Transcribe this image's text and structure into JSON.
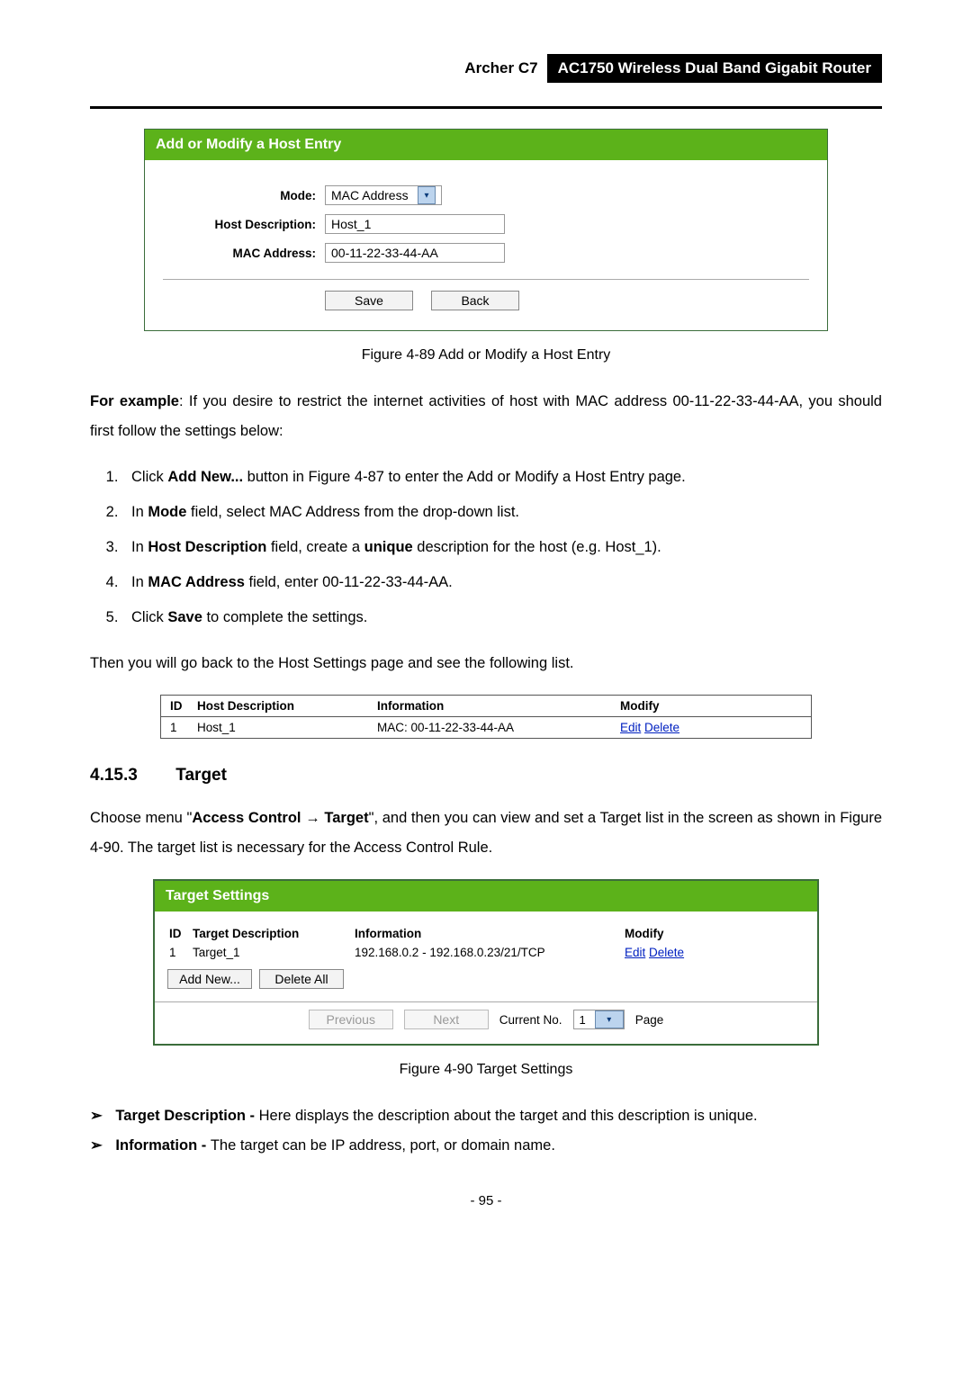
{
  "header": {
    "left": "Archer C7",
    "right": "AC1750 Wireless Dual Band Gigabit Router"
  },
  "host_panel": {
    "title": "Add or Modify a Host Entry",
    "mode_label": "Mode:",
    "mode_value": "MAC Address",
    "desc_label": "Host Description:",
    "desc_value": "Host_1",
    "mac_label": "MAC Address:",
    "mac_value": "00-11-22-33-44-AA",
    "save": "Save",
    "back": "Back"
  },
  "fig1_caption": "Figure 4-89 Add or Modify a Host Entry",
  "para1_a": "For example",
  "para1_b": ": If you desire to restrict the internet activities of host with MAC address 00-11-22-33-44-AA, you should first follow the settings below:",
  "steps": {
    "s1a": "Click ",
    "s1b": "Add New...",
    "s1c": " button in Figure 4-87 to enter the Add or Modify a Host Entry page.",
    "s2a": "In ",
    "s2b": "Mode",
    "s2c": " field, select MAC Address from the drop-down list.",
    "s3a": "In ",
    "s3b": "Host Description",
    "s3c": " field, create a ",
    "s3d": "unique",
    "s3e": " description for the host (e.g. Host_1).",
    "s4a": "In ",
    "s4b": "MAC Address",
    "s4c": " field, enter 00-11-22-33-44-AA.",
    "s5a": "Click ",
    "s5b": "Save",
    "s5c": " to complete the settings."
  },
  "para2": "Then you will go back to the Host Settings page and see the following list.",
  "hostlist": {
    "head_id": "ID",
    "head_desc": "Host Description",
    "head_info": "Information",
    "head_mod": "Modify",
    "row_id": "1",
    "row_desc": "Host_1",
    "row_info": "MAC: 00-11-22-33-44-AA",
    "row_edit": "Edit",
    "row_delete": "Delete"
  },
  "section": {
    "num": "4.15.3",
    "title": "Target"
  },
  "para3_a": "Choose menu \"",
  "para3_b": "Access Control",
  "para3_c": " → ",
  "para3_d": "Target",
  "para3_e": "\", and then you can view and set a Target list in the screen as shown in Figure 4-90. The target list is necessary for the Access Control Rule.",
  "target_panel": {
    "title": "Target Settings",
    "head_id": "ID",
    "head_desc": "Target Description",
    "head_info": "Information",
    "head_mod": "Modify",
    "row_id": "1",
    "row_desc": "Target_1",
    "row_info": "192.168.0.2 - 192.168.0.23/21/TCP",
    "row_edit": "Edit",
    "row_delete": "Delete",
    "add_new": "Add New...",
    "delete_all": "Delete All",
    "previous": "Previous",
    "next": "Next",
    "current_lbl": "Current No.",
    "current_val": "1",
    "page_lbl": "Page"
  },
  "fig2_caption": "Figure 4-90 Target Settings",
  "bullets": {
    "b1a": "Target Description - ",
    "b1b": "Here displays the description about the target and this description is unique.",
    "b2a": "Information - ",
    "b2b": "The target can be IP address, port, or domain name."
  },
  "page_number": "- 95 -"
}
